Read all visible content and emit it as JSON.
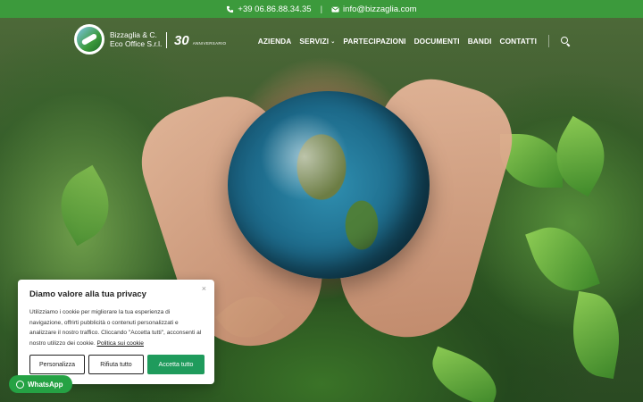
{
  "topbar": {
    "phone": "+39 06.86.88.34.35",
    "separator": "|",
    "email": "info@bizzaglia.com"
  },
  "brand": {
    "line1": "Bizzaglia & C.",
    "line2": "Eco Office S.r.l.",
    "anniversary_number": "30",
    "anniversary_label": "ANNIVERSARIO"
  },
  "nav": {
    "items": [
      "AZIENDA",
      "SERVIZI",
      "PARTECIPAZIONI",
      "DOCUMENTI",
      "BANDI",
      "CONTATTI"
    ]
  },
  "cookie": {
    "title": "Diamo valore alla tua privacy",
    "close": "×",
    "text": "Utilizziamo i cookie per migliorare la tua esperienza di navigazione, offrirti pubblicità o contenuti personalizzati e analizzare il nostro traffico. Cliccando \"Accetta tutti\", acconsenti al nostro utilizzo dei cookie.",
    "policy_link": "Politica sui cookie",
    "btn_customize": "Personalizza",
    "btn_reject": "Rifiuta tutto",
    "btn_accept": "Accetta tutto"
  },
  "whatsapp": {
    "label": "WhatsApp"
  },
  "colors": {
    "topbar": "#3c9a3c",
    "accept_button": "#1f9b5c",
    "whatsapp": "#25a244"
  }
}
